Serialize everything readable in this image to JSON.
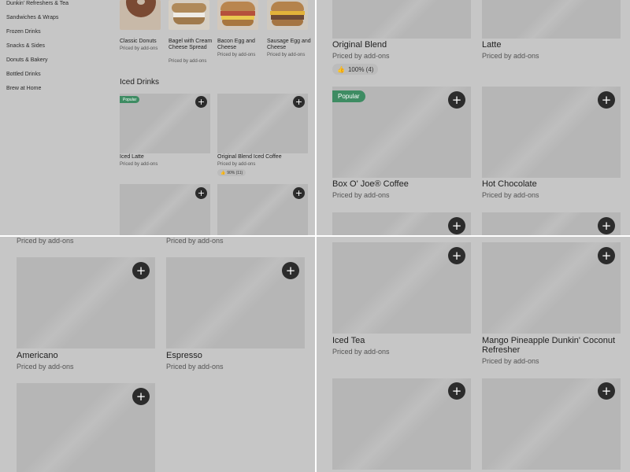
{
  "sidebar": {
    "items": [
      {
        "label": "Dunkin' Refreshers & Tea"
      },
      {
        "label": "Sandwiches & Wraps"
      },
      {
        "label": "Frozen Drinks"
      },
      {
        "label": "Snacks & Sides"
      },
      {
        "label": "Donuts & Bakery"
      },
      {
        "label": "Bottled Drinks"
      },
      {
        "label": "Brew at Home"
      }
    ]
  },
  "food_row": [
    {
      "name": "Classic Donuts",
      "price": "Priced by add-ons"
    },
    {
      "name": "Bagel with Cream Cheese Spread",
      "price": "Priced by add-ons"
    },
    {
      "name": "Bacon Egg and Cheese",
      "price": "Priced by add-ons"
    },
    {
      "name": "Sausage Egg and Cheese",
      "price": "Priced by add-ons"
    }
  ],
  "iced_section": {
    "title": "Iced Drinks",
    "items": [
      {
        "name": "Iced Latte",
        "price": "Priced by add-ons",
        "badge": "Popular"
      },
      {
        "name": "Original Blend Iced Coffee",
        "price": "Priced by add-ons",
        "rating": "90% (11)"
      }
    ]
  },
  "hot_panel": {
    "items": [
      {
        "name": "Original Blend",
        "price": "Priced by add-ons",
        "rating": "100% (4)"
      },
      {
        "name": "Latte",
        "price": "Priced by add-ons"
      },
      {
        "name": "Box O' Joe® Coffee",
        "price": "Priced by add-ons",
        "badge": "Popular"
      },
      {
        "name": "Hot Chocolate",
        "price": "Priced by add-ons"
      }
    ]
  },
  "espresso_panel": {
    "top_prices": [
      "Priced by add-ons",
      "Priced by add-ons"
    ],
    "items": [
      {
        "name": "Americano",
        "price": "Priced by add-ons"
      },
      {
        "name": "Espresso",
        "price": "Priced by add-ons"
      }
    ]
  },
  "tea_panel": {
    "items": [
      {
        "name": "Iced Tea",
        "price": "Priced by add-ons"
      },
      {
        "name": "Mango Pineapple Dunkin' Coconut Refresher",
        "price": "Priced by add-ons"
      }
    ]
  },
  "icons": {
    "add": "+",
    "thumbs_up": "👍"
  },
  "colors": {
    "overlay": "#c6c6c6",
    "placeholder": "#b6b6b6",
    "add_button": "#2c2c2c",
    "popular_badge": "#3e8c63"
  }
}
